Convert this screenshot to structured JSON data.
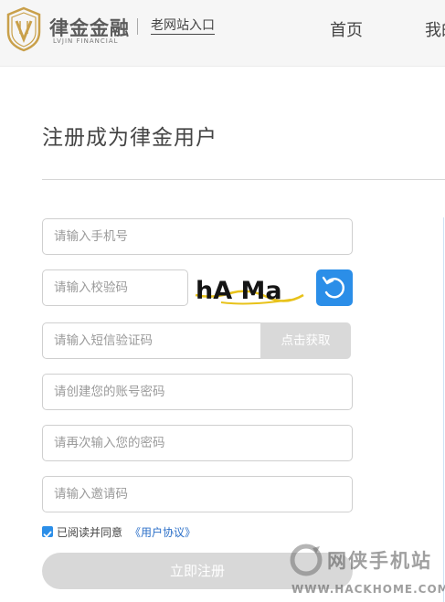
{
  "header": {
    "brand_name": "律金金融",
    "brand_sub": "LVJIN FINANCIAL",
    "old_site_link": "老网站入口",
    "nav": {
      "home": "首页",
      "my": "我的"
    }
  },
  "page": {
    "title": "注册成为律金用户"
  },
  "form": {
    "phone_placeholder": "请输入手机号",
    "captcha_placeholder": "请输入校验码",
    "captcha_text": "hA Ma",
    "sms_placeholder": "请输入短信验证码",
    "sms_button": "点击获取",
    "password_placeholder": "请创建您的账号密码",
    "confirm_placeholder": "请再次输入您的密码",
    "invite_placeholder": "请输入邀请码",
    "agree_checked": true,
    "agree_text": "已阅读并同意",
    "agree_link": "《用户协议》",
    "submit_label": "立即注册"
  },
  "watermark": {
    "text": "网侠手机站",
    "url": "WWW.HACKHOME.COM"
  },
  "colors": {
    "accent": "#2b8ee8",
    "disabled": "#d9d9d9",
    "brand_gold": "#c9a04a"
  }
}
